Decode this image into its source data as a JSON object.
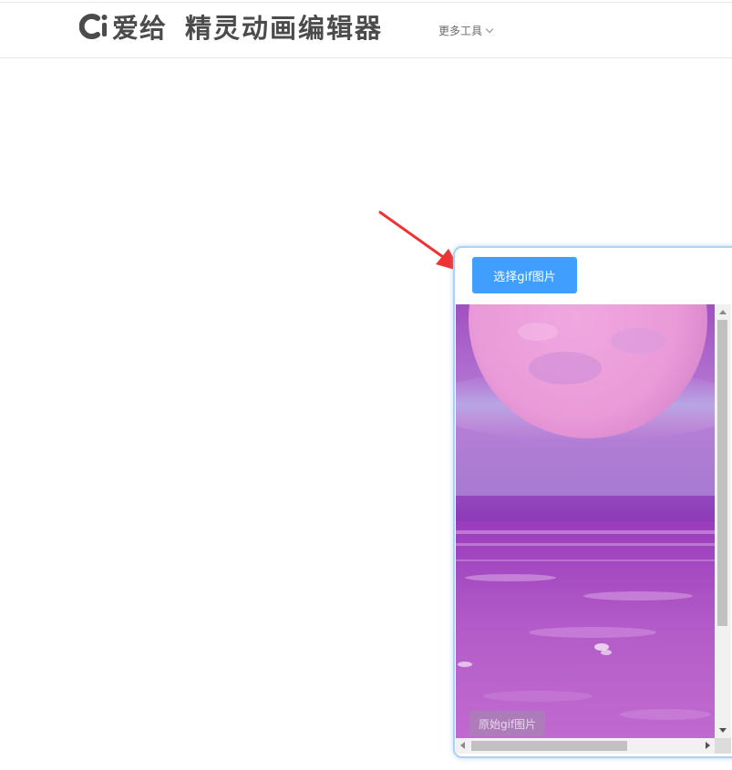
{
  "header": {
    "logo_text": "爱给",
    "subtitle": "精灵动画编辑器",
    "more_tools_label": "更多工具"
  },
  "panel": {
    "select_button_label": "选择gif图片",
    "image_caption": "原始gif图片"
  },
  "colors": {
    "accent": "#409eff",
    "panel_border": "#a9d3f5",
    "annotation_arrow": "#ee3333"
  },
  "icons": {
    "logo": "ci-logo-icon",
    "dropdown": "chevron-down-icon",
    "annotation": "red-arrow-icon"
  }
}
